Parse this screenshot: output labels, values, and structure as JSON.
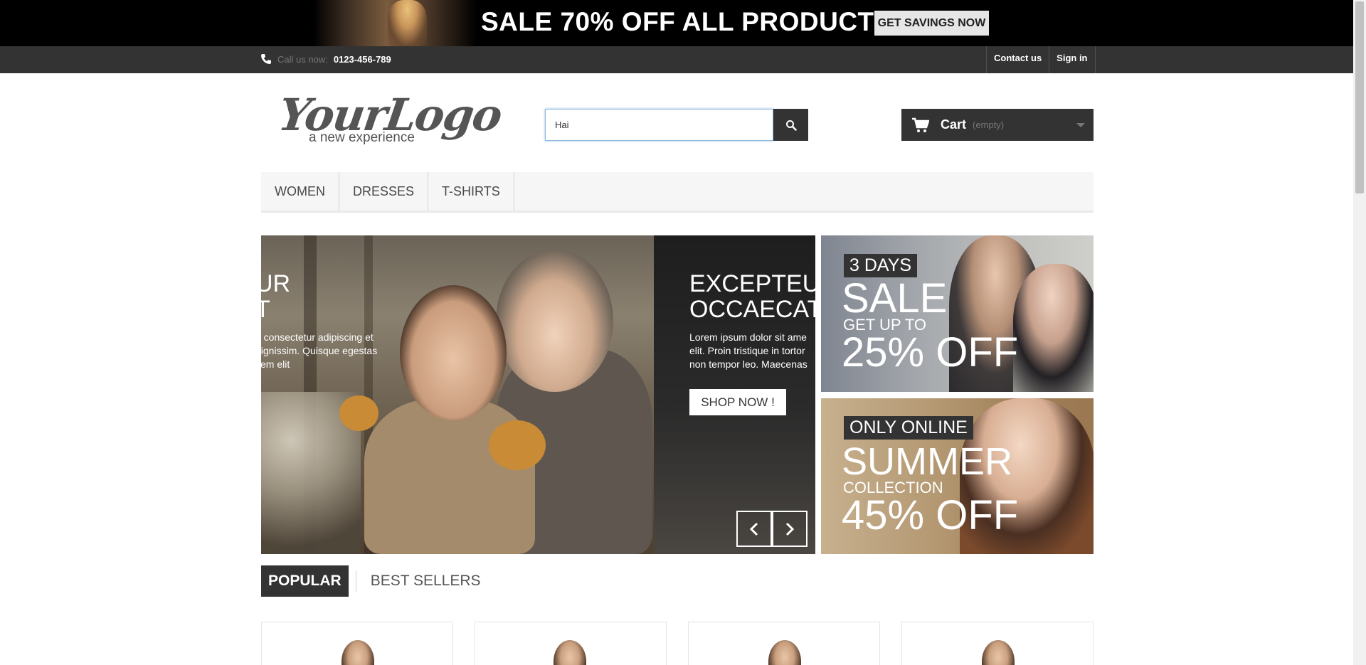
{
  "banner": {
    "headline": "SALE 70% OFF ALL PRODUCTS",
    "cta": "GET SAVINGS NOW"
  },
  "nav": {
    "phone_label": "Call us now:",
    "phone_number": "0123-456-789",
    "links": [
      "Contact us",
      "Sign in"
    ]
  },
  "logo": {
    "script": "YourLogo",
    "tagline": "a new experience"
  },
  "search": {
    "value": "Hai",
    "icon": "search-icon"
  },
  "cart": {
    "label": "Cart",
    "status": "(empty)"
  },
  "menu": [
    "WOMEN",
    "DRESSES",
    "T-SHIRTS"
  ],
  "slider": {
    "slide1": {
      "heading_line1": "UR",
      "heading_line2": "T",
      "text": "t, consectetur adipiscing et dignissim. Quisque egestas sem elit"
    },
    "slide2": {
      "heading_line1": "EXCEPTEU",
      "heading_line2": "OCCAECAT",
      "text_line1": "Lorem ipsum dolor sit ame",
      "text_line2": "elit. Proin tristique in tortor",
      "text_line3": "non tempor leo. Maecenas"
    },
    "shop_button": "SHOP NOW !"
  },
  "promos": [
    {
      "tag": "3 DAYS",
      "big": "SALE",
      "small": "GET UP TO",
      "off": "25% OFF"
    },
    {
      "tag": "ONLY ONLINE",
      "big": "SUMMER",
      "small": "COLLECTION",
      "off": "45% OFF"
    }
  ],
  "tabs": [
    "POPULAR",
    "BEST SELLERS"
  ],
  "colors": {
    "dark": "#333333",
    "banner_bg": "#000000",
    "menu_bg": "#f6f6f6",
    "search_focus": "#8fb7dd"
  }
}
